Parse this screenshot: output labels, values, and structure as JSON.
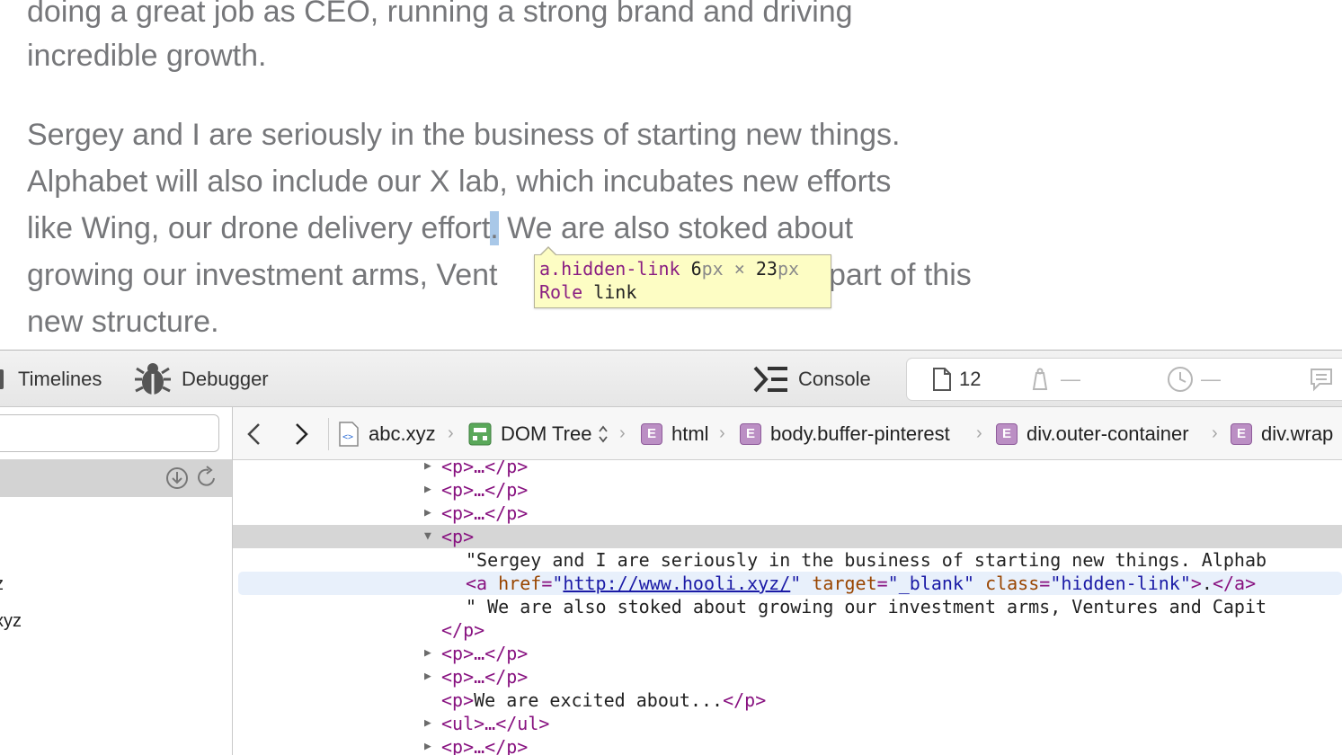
{
  "article": {
    "lines": [
      "doing a great job as CEO, running a strong brand and driving",
      "incredible growth.",
      "Sergey and I are seriously in the business of starting new things.",
      "Alphabet will also include our X lab, which incubates new efforts",
      "like Wing, our drone delivery effort",
      ".",
      " We are also stoked about",
      "growing our investment arms, Vent",
      "part of this",
      "new structure."
    ]
  },
  "tooltip": {
    "selector": "a.hidden-link",
    "width": "6",
    "height": "23",
    "unit": "px",
    "times": "×",
    "role_label": "Role",
    "role_value": "link"
  },
  "toolbar": {
    "timelines": "Timelines",
    "debugger": "Debugger",
    "console": "Console",
    "resources_count": "12",
    "dash1": "—",
    "dash2": "—"
  },
  "leftpane": {
    "items": [
      "z",
      "xyz"
    ]
  },
  "navbar": {
    "crumbs": [
      "abc.xyz",
      "DOM Tree",
      "html",
      "body.buffer-pinterest",
      "div.outer-container",
      "div.wrap"
    ],
    "badge": "E"
  },
  "dom": {
    "collapsed_p": "<p>…</p>",
    "open_p": "<p>",
    "text1": "\"Sergey and I are seriously in the business of starting new things. Alphab",
    "a_open": "<a",
    "href_attr": "href",
    "href_val": "http://www.hooli.xyz/",
    "target_attr": "target",
    "target_val": "_blank",
    "class_attr": "class",
    "class_val": "hidden-link",
    "a_text": ".",
    "a_close": "</a>",
    "text2": "\" We are also stoked about growing our investment arms, Ventures and Capit",
    "close_p": "</p>",
    "p_open": "<p>",
    "p_text": "We are excited about...",
    "p_close": "</p>",
    "ul": "<ul>…</ul>"
  }
}
